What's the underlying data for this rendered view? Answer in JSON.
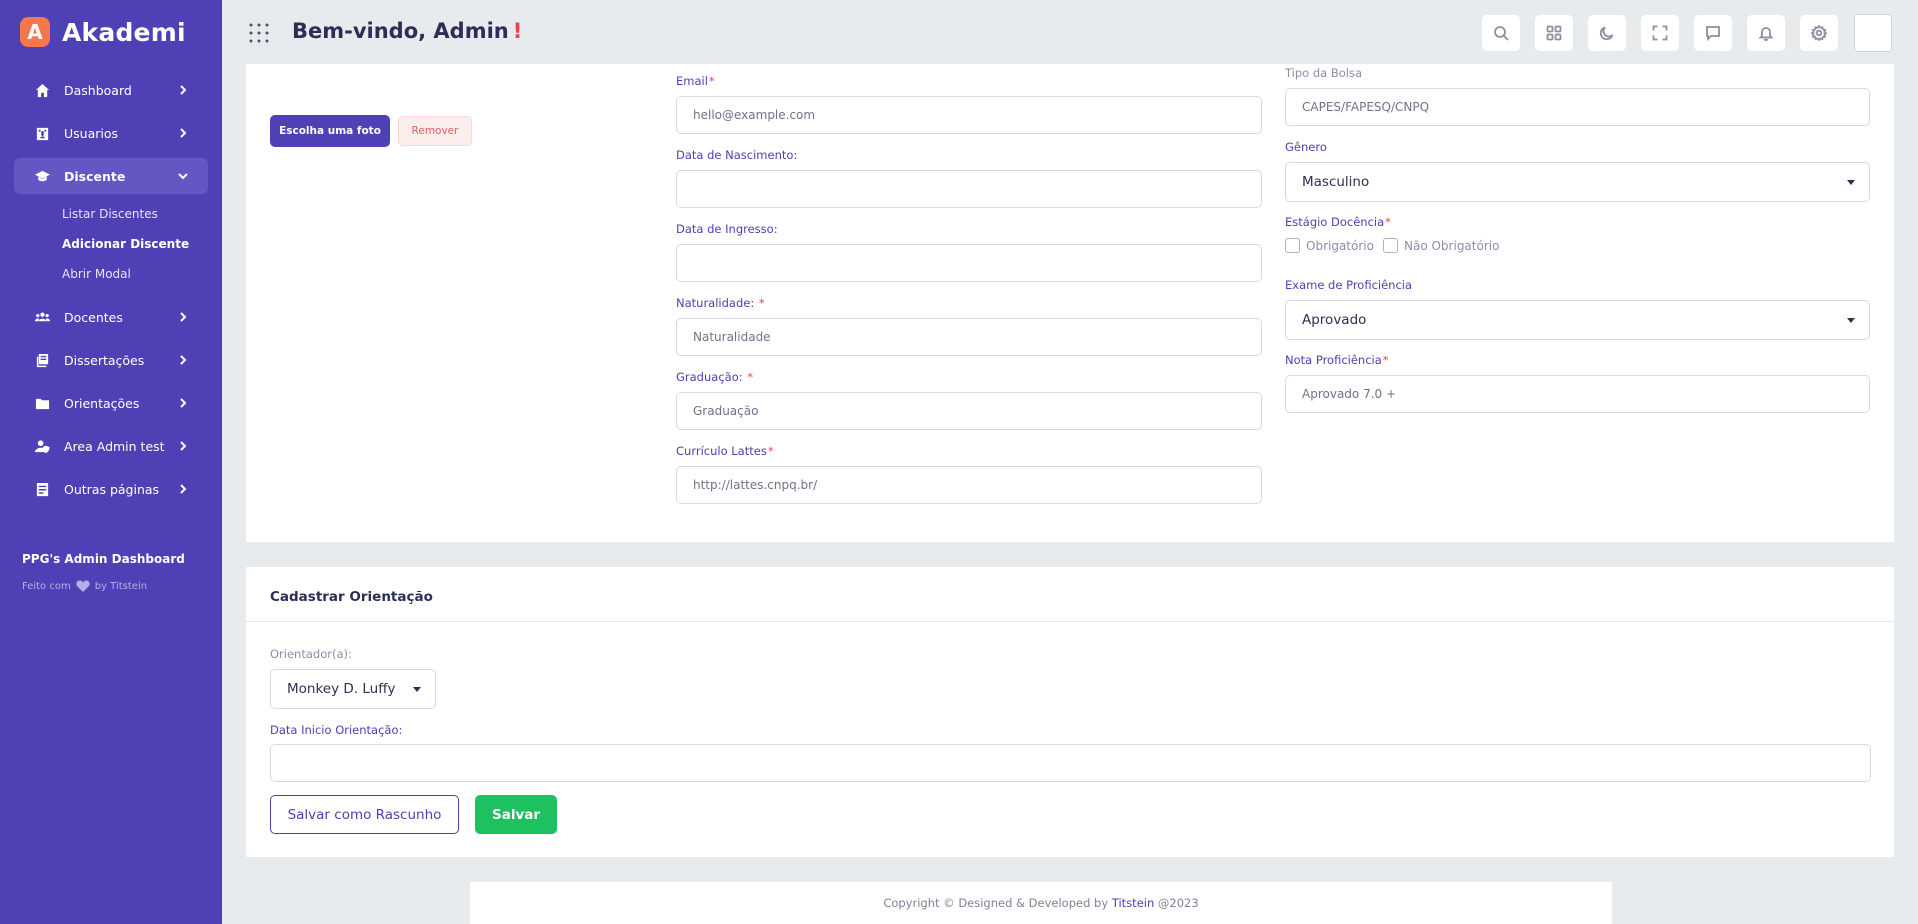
{
  "brand": {
    "logo_letter": "A",
    "name": "Akademi"
  },
  "sidebar": {
    "items": [
      {
        "label": "Dashboard",
        "icon": "home-icon"
      },
      {
        "label": "Usuarios",
        "icon": "users-building-icon"
      },
      {
        "label": "Discente",
        "icon": "graduation-cap-icon",
        "active": true
      },
      {
        "label": "Docentes",
        "icon": "people-group-icon"
      },
      {
        "label": "Dissertações",
        "icon": "books-icon"
      },
      {
        "label": "Orientações",
        "icon": "folder-icon"
      },
      {
        "label": "Area Admin test",
        "icon": "user-shield-icon"
      },
      {
        "label": "Outras páginas",
        "icon": "document-icon"
      }
    ],
    "submenu": [
      "Listar Discentes",
      "Adicionar Discente",
      "Abrir Modal"
    ],
    "footer_title": "PPG's Admin Dashboard",
    "footer_made_with": "Feito com",
    "footer_by": "by Titstein"
  },
  "header": {
    "welcome": "Bem-vindo, Admin",
    "exclamation": "!"
  },
  "photo": {
    "choose_label": "Escolha uma foto",
    "remove_label": "Remover"
  },
  "form": {
    "email": {
      "label": "Email",
      "placeholder": "hello@example.com"
    },
    "birth": {
      "label": "Data de Nascimento:",
      "value": ""
    },
    "ingress": {
      "label": "Data de Ingresso:",
      "value": ""
    },
    "naturality": {
      "label": "Naturalidade:",
      "placeholder": "Naturalidade"
    },
    "graduation": {
      "label": "Graduação:",
      "placeholder": "Graduação"
    },
    "lattes": {
      "label": "Currículo Lattes",
      "placeholder": "http://lattes.cnpq.br/"
    },
    "scholarship": {
      "label": "Tipo da Bolsa",
      "placeholder": "CAPES/FAPESQ/CNPQ"
    },
    "gender": {
      "label": "Gênero",
      "value": "Masculino"
    },
    "teaching": {
      "label": "Estágio Docência",
      "opt1": "Obrigatório",
      "opt2": "Não Obrigatório"
    },
    "proficiency_exam": {
      "label": "Exame de Proficiência",
      "value": "Aprovado"
    },
    "proficiency_grade": {
      "label": "Nota Proficiência",
      "placeholder": "Aprovado 7.0 +"
    },
    "required_mark": "*"
  },
  "orientation": {
    "title": "Cadastrar Orientação",
    "advisor_label": "Orientador(a):",
    "advisor_value": "Monkey D. Luffy",
    "start_label": "Data Inicio Orientação:",
    "start_value": "",
    "draft_label": "Salvar como Rascunho",
    "save_label": "Salvar"
  },
  "footer": {
    "text": "Copyright © Designed & Developed by",
    "brand": "Titstein",
    "year": "@2023"
  }
}
